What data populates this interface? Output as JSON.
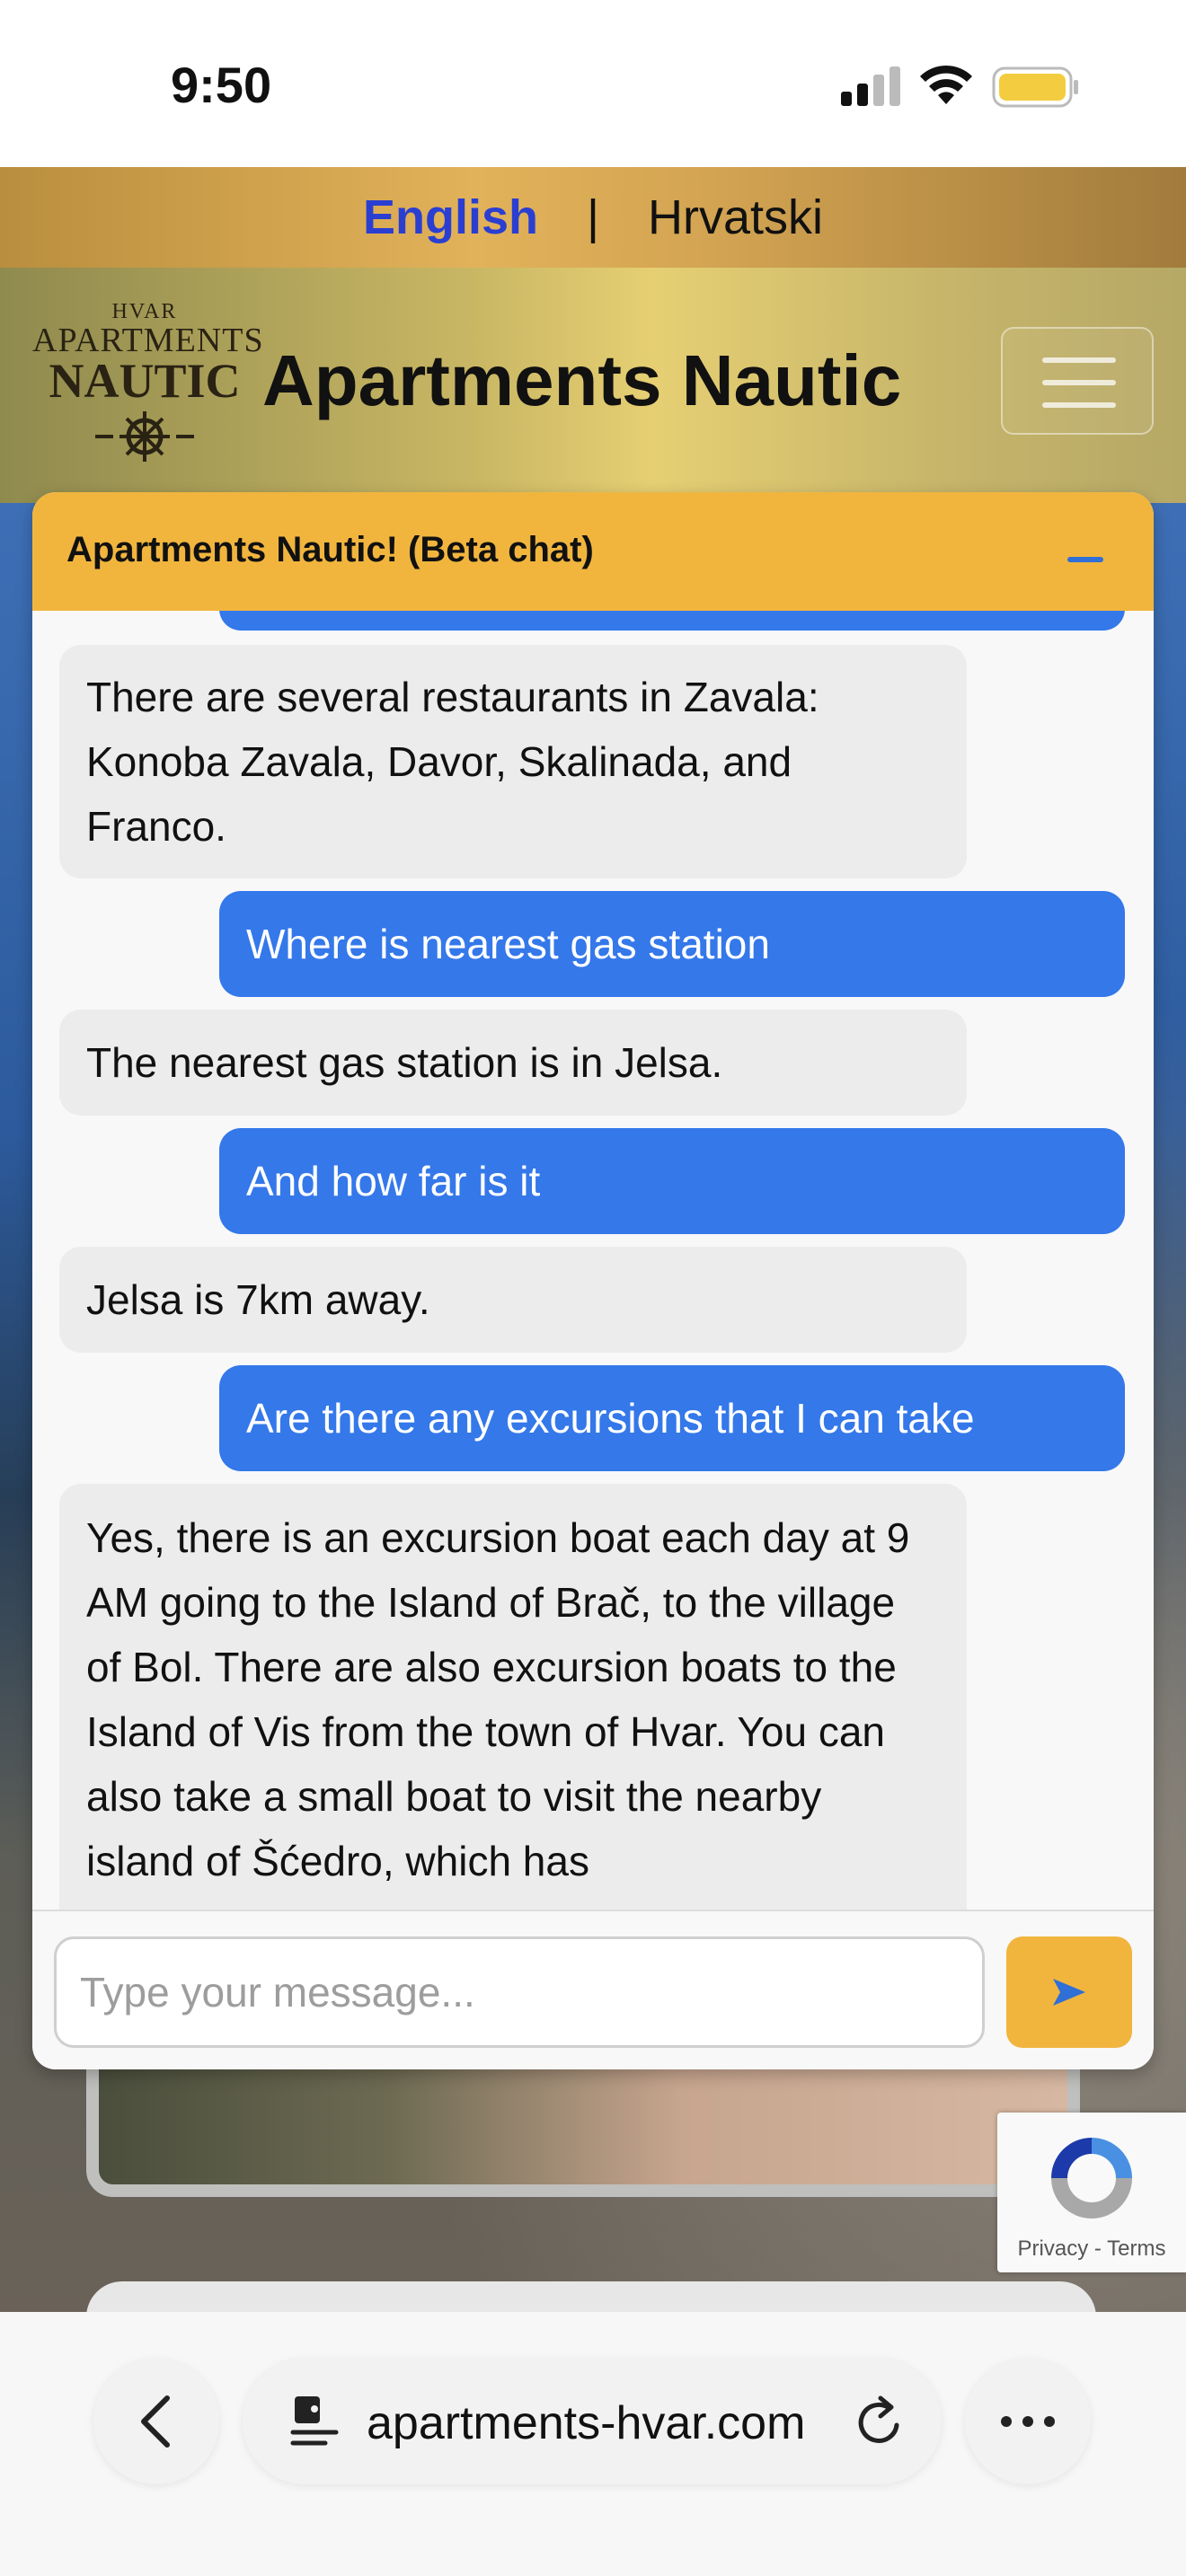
{
  "status_bar": {
    "time": "9:50"
  },
  "language": {
    "english": "English",
    "separator": "|",
    "croatian": "Hrvatski"
  },
  "header": {
    "logo": {
      "line1": "HVAR",
      "line2": "APARTMENTS",
      "line3": "NAUTIC"
    },
    "title": "Apartments Nautic"
  },
  "chat": {
    "title": "Apartments Nautic! (Beta chat)",
    "messages": [
      {
        "role": "bot",
        "text": "There are several restaurants in Zavala: Konoba Zavala, Davor, Skalinada, and Franco."
      },
      {
        "role": "user",
        "text": "Where is nearest gas station"
      },
      {
        "role": "bot",
        "text": "The nearest gas station is in Jelsa."
      },
      {
        "role": "user",
        "text": "And how far is it"
      },
      {
        "role": "bot",
        "text": "Jelsa is 7km away."
      },
      {
        "role": "user",
        "text": "Are there any excursions that I can take"
      },
      {
        "role": "bot",
        "text": "Yes, there is an excursion boat each day at 9 AM going to the Island of Brač, to the village of Bol. There are also excursion boats to the Island of Vis from the town of Hvar. You can also take a small boat to visit the nearby island of Šćedro, which has"
      }
    ],
    "input_placeholder": "Type your message...",
    "send_icon": "send-arrow-icon"
  },
  "recaptcha": {
    "privacy": "Privacy",
    "separator": "-",
    "terms": "Terms"
  },
  "browser": {
    "url": "apartments-hvar.com"
  },
  "colors": {
    "accent": "#f1b53e",
    "user_bubble": "#3478ea",
    "bot_bubble": "#ececec",
    "language_active": "#2a3fd1"
  }
}
